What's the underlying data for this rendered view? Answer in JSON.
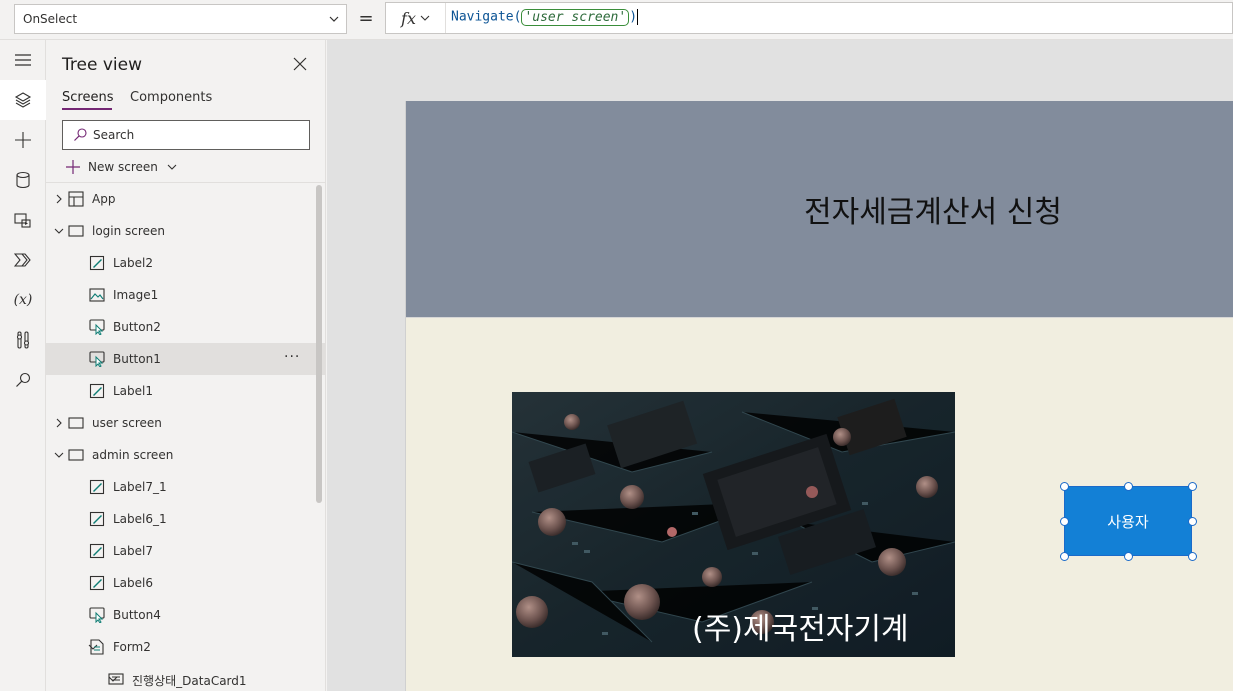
{
  "formula_bar": {
    "property": "OnSelect",
    "equals": "=",
    "fx": "fx",
    "formula_func": "Navigate",
    "formula_open": "(",
    "formula_arg": "'user screen'",
    "formula_close": ")"
  },
  "rail": {
    "icons": [
      "hamburger-icon",
      "layers-icon",
      "plus-icon",
      "database-icon",
      "media-icon",
      "power-automate-icon",
      "variables-icon",
      "tools-icon",
      "search-icon"
    ],
    "variables_glyph": "(x)"
  },
  "tree": {
    "title": "Tree view",
    "tabs": {
      "screens": "Screens",
      "components": "Components"
    },
    "search_placeholder": "Search",
    "new_screen": "New screen",
    "nodes": [
      {
        "label": "App",
        "kind": "app",
        "level": 0,
        "expander": "right"
      },
      {
        "label": "login screen",
        "kind": "screen",
        "level": 0,
        "expander": "down"
      },
      {
        "label": "Label2",
        "kind": "label",
        "level": 1
      },
      {
        "label": "Image1",
        "kind": "image",
        "level": 1
      },
      {
        "label": "Button2",
        "kind": "button",
        "level": 1
      },
      {
        "label": "Button1",
        "kind": "button",
        "level": 1,
        "selected": true
      },
      {
        "label": "Label1",
        "kind": "label",
        "level": 1
      },
      {
        "label": "user screen",
        "kind": "screen",
        "level": 0,
        "expander": "right"
      },
      {
        "label": "admin screen",
        "kind": "screen",
        "level": 0,
        "expander": "down"
      },
      {
        "label": "Label7_1",
        "kind": "label",
        "level": 1
      },
      {
        "label": "Label6_1",
        "kind": "label",
        "level": 1
      },
      {
        "label": "Label7",
        "kind": "label",
        "level": 1
      },
      {
        "label": "Label6",
        "kind": "label",
        "level": 1
      },
      {
        "label": "Button4",
        "kind": "button",
        "level": 1
      },
      {
        "label": "Form2",
        "kind": "form",
        "level": 1,
        "expander": "down"
      },
      {
        "label": "진행상태_DataCard1",
        "kind": "datacard",
        "level": 2,
        "expander": "down"
      }
    ],
    "more_label": "···"
  },
  "canvas": {
    "header_title": "전자세금계산서 신청",
    "company_label": "(주)제국전자기계",
    "user_button": "사용자"
  },
  "colors": {
    "accent": "#742774",
    "header_band": "#828c9c",
    "screen_bg": "#f1eee0",
    "button_blue": "#1380d6"
  }
}
